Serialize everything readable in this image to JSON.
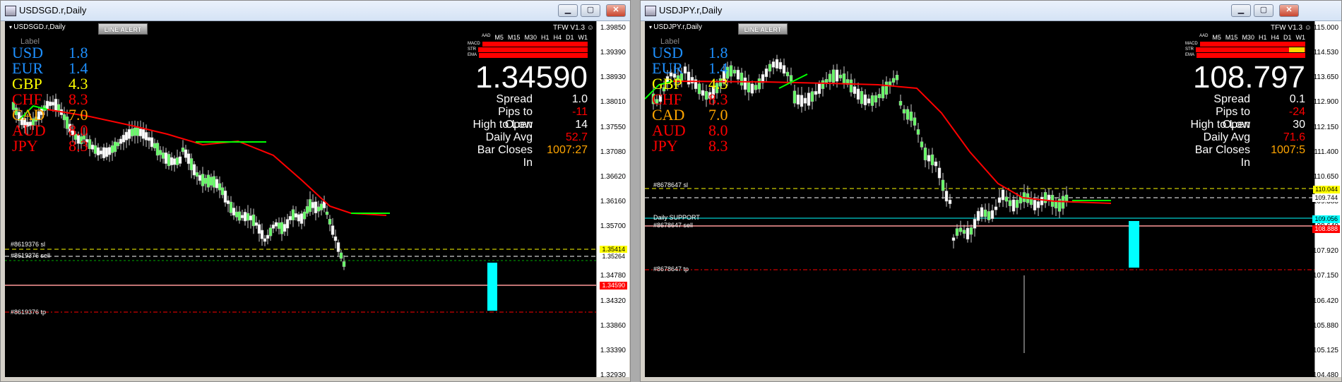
{
  "colors": {
    "bg": "#000000",
    "green": "#00FF00",
    "red": "#FF0000",
    "cyan": "#00FFFF",
    "yellow": "#FFFF00",
    "orange": "#FFA500",
    "blue": "#1E90FF"
  },
  "windows": [
    {
      "title": "USDSGD.r,Daily",
      "symbol_label": "USDSGD.r,Daily",
      "alert_label": "LINE ALERT",
      "version_label": "TFW V1.3 ☺",
      "small_label": "Label",
      "currencies": [
        {
          "name": "USD",
          "value": "1.8",
          "color": "#1E90FF"
        },
        {
          "name": "EUR",
          "value": "1.4",
          "color": "#1E90FF"
        },
        {
          "name": "GBP",
          "value": "4.3",
          "color": "#FFFF00"
        },
        {
          "name": "CHF",
          "value": "8.3",
          "color": "#FF0000"
        },
        {
          "name": "CAD",
          "value": "7.0",
          "color": "#FFA500"
        },
        {
          "name": "AUD",
          "value": "8.0",
          "color": "#FF0000"
        },
        {
          "name": "JPY",
          "value": "8.3",
          "color": "#FF0000"
        }
      ],
      "timeframes": [
        "M5",
        "M15",
        "M30",
        "H1",
        "H4",
        "D1",
        "W1"
      ],
      "tf_header_small": "AAD",
      "indicators": [
        {
          "name": "MACD",
          "yellow_cells": []
        },
        {
          "name": "STR",
          "yellow_cells": []
        },
        {
          "name": "EMA",
          "yellow_cells": []
        }
      ],
      "price": "1.34590",
      "info": [
        {
          "key": "Spread",
          "value": "1.0",
          "color": "#FFFFFF"
        },
        {
          "key": "Pips to Open",
          "value": "-11",
          "color": "#FF0000"
        },
        {
          "key": "High to Low",
          "value": "14",
          "color": "#FFFFFF"
        },
        {
          "key": "Daily Avg",
          "value": "52.7",
          "color": "#FF0000"
        },
        {
          "key": "Bar Closes In",
          "value": "1007:27",
          "color": "#FFA500"
        }
      ],
      "y_ticks": [
        "1.39850",
        "1.39390",
        "1.38930",
        "1.38010",
        "1.37550",
        "1.37080",
        "1.36620",
        "1.36160",
        "1.35700",
        "1.35240",
        "1.34780",
        "1.34320",
        "1.33860",
        "1.33390",
        "1.32930"
      ],
      "price_tags": [
        {
          "text": "1.35414",
          "bg": "#FFFF00",
          "fg": "#000000"
        },
        {
          "text": "1.35264",
          "bg": "#FFFFFF",
          "fg": "#000000"
        },
        {
          "text": "1.34590",
          "bg": "#FF0000",
          "fg": "#FFFFFF"
        }
      ],
      "order_labels": [
        "#8619376 sl",
        "#8619376 sell",
        "#8619376 tp"
      ]
    },
    {
      "title": "USDJPY.r,Daily",
      "symbol_label": "USDJPY.r,Daily",
      "alert_label": "LINE ALERT",
      "version_label": "TFW V1.3 ☺",
      "small_label": "Label",
      "currencies": [
        {
          "name": "USD",
          "value": "1.8",
          "color": "#1E90FF"
        },
        {
          "name": "EUR",
          "value": "1.4",
          "color": "#1E90FF"
        },
        {
          "name": "GBP",
          "value": "4.3",
          "color": "#FFFF00"
        },
        {
          "name": "CHF",
          "value": "8.3",
          "color": "#FF0000"
        },
        {
          "name": "CAD",
          "value": "7.0",
          "color": "#FFA500"
        },
        {
          "name": "AUD",
          "value": "8.0",
          "color": "#FF0000"
        },
        {
          "name": "JPY",
          "value": "8.3",
          "color": "#FF0000"
        }
      ],
      "timeframes": [
        "M5",
        "M15",
        "M30",
        "H1",
        "H4",
        "D1",
        "W1"
      ],
      "tf_header_small": "AAD",
      "indicators": [
        {
          "name": "MACD",
          "yellow_cells": []
        },
        {
          "name": "STR",
          "yellow_cells": [
            6
          ]
        },
        {
          "name": "EMA",
          "yellow_cells": []
        }
      ],
      "price": "108.797",
      "info": [
        {
          "key": "Spread",
          "value": "0.1",
          "color": "#FFFFFF"
        },
        {
          "key": "Pips to Open",
          "value": "-24",
          "color": "#FF0000"
        },
        {
          "key": "High to Low",
          "value": "30",
          "color": "#FFFFFF"
        },
        {
          "key": "Daily Avg",
          "value": "71.6",
          "color": "#FF0000"
        },
        {
          "key": "Bar Closes In",
          "value": "1007:5",
          "color": "#FFA500"
        }
      ],
      "y_ticks": [
        "115.000",
        "114.530",
        "113.650",
        "112.900",
        "112.150",
        "111.400",
        "110.650",
        "109.385",
        "108.640",
        "107.920",
        "107.150",
        "106.420",
        "105.880",
        "105.125",
        "104.480"
      ],
      "price_tags": [
        {
          "text": "110.044",
          "bg": "#FFFF00",
          "fg": "#000000"
        },
        {
          "text": "109.744",
          "bg": "#FFFFFF",
          "fg": "#000000"
        },
        {
          "text": "109.056",
          "bg": "#00FFFF",
          "fg": "#000000"
        },
        {
          "text": "108.888",
          "bg": "#FF0000",
          "fg": "#FFFFFF"
        }
      ],
      "order_labels": [
        "#8678647 sl",
        "Daily SUPPORT",
        "#8678647 sell",
        "#8678647 tp"
      ]
    }
  ]
}
